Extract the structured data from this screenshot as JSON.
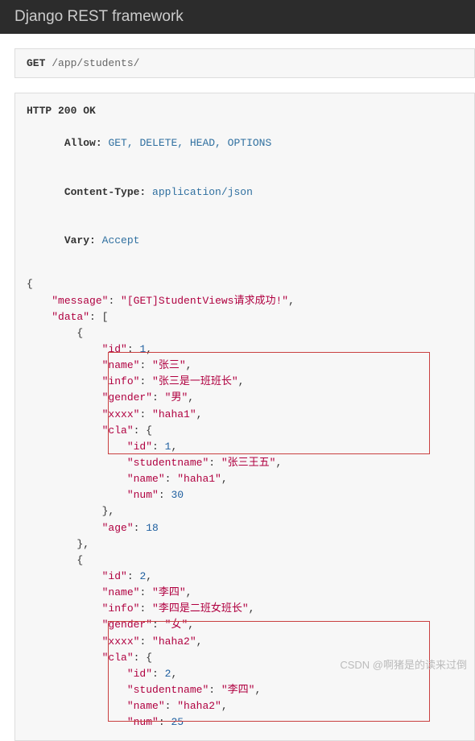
{
  "navbar": {
    "title": "Django REST framework"
  },
  "request": {
    "method": "GET",
    "path": "/app/students/"
  },
  "response": {
    "status": "HTTP 200 OK",
    "headers": {
      "allow_key": "Allow:",
      "allow_val": "GET, DELETE, HEAD, OPTIONS",
      "ctype_key": "Content-Type:",
      "ctype_val": "application/json",
      "vary_key": "Vary:",
      "vary_val": "Accept"
    },
    "body": {
      "message_key": "\"message\"",
      "message_val": "\"[GET]StudentViews请求成功!\"",
      "data_key": "\"data\"",
      "s1": {
        "id_k": "\"id\"",
        "id_v": "1",
        "name_k": "\"name\"",
        "name_v": "\"张三\"",
        "info_k": "\"info\"",
        "info_v": "\"张三是一班班长\"",
        "gender_k": "\"gender\"",
        "gender_v": "\"男\"",
        "xxxx_k": "\"xxxx\"",
        "xxxx_v": "\"haha1\"",
        "cla_k": "\"cla\"",
        "cla_id_k": "\"id\"",
        "cla_id_v": "1",
        "cla_sn_k": "\"studentname\"",
        "cla_sn_v": "\"张三王五\"",
        "cla_name_k": "\"name\"",
        "cla_name_v": "\"haha1\"",
        "cla_num_k": "\"num\"",
        "cla_num_v": "30",
        "age_k": "\"age\"",
        "age_v": "18"
      },
      "s2": {
        "id_k": "\"id\"",
        "id_v": "2",
        "name_k": "\"name\"",
        "name_v": "\"李四\"",
        "info_k": "\"info\"",
        "info_v": "\"李四是二班女班长\"",
        "gender_k": "\"gender\"",
        "gender_v": "\"女\"",
        "xxxx_k": "\"xxxx\"",
        "xxxx_v": "\"haha2\"",
        "cla_k": "\"cla\"",
        "cla_id_k": "\"id\"",
        "cla_id_v": "2",
        "cla_sn_k": "\"studentname\"",
        "cla_sn_v": "\"李四\"",
        "cla_name_k": "\"name\"",
        "cla_name_v": "\"haha2\"",
        "cla_num_k": "\"num\"",
        "cla_num_v": "25"
      }
    }
  },
  "watermark": "CSDN @啊猪是的读来过倒"
}
